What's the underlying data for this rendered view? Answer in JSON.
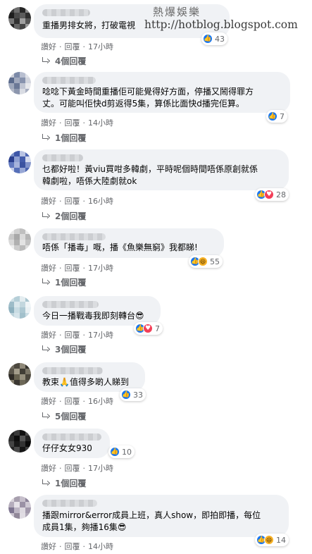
{
  "watermark": {
    "title": "熱爆娛樂",
    "url": "http://hotblog.blogspot.com"
  },
  "labels": {
    "like": "讚好",
    "reply": "回覆",
    "sep": "·"
  },
  "colors": {
    "like": "#1877f2",
    "love": "#f33e58",
    "haha": "#f7b125",
    "bubble": "#f0f2f5",
    "meta": "#65676b"
  },
  "comments": [
    {
      "text_lines": [
        "重播男排女將，打破電視"
      ],
      "reactions": [
        "like"
      ],
      "reaction_count": "43",
      "time": "17小時",
      "replies": "4個回覆"
    },
    {
      "text_lines": [
        "唸唸下黃金時間重播佢可能覺得好方面，停播又鬧得罪方",
        "丈。可能叫佢快d剪返得5集，算係比面快d播完佢算。"
      ],
      "reactions": [
        "like"
      ],
      "reaction_count": "7",
      "time": "14小時",
      "replies": "1個回覆"
    },
    {
      "text_lines": [
        "乜都好啦！黃viu買咁多韓劇，平時呢個時間唔係原創就係",
        "韓劇啦，唔係大陸劇就ok"
      ],
      "reactions": [
        "like",
        "love"
      ],
      "reaction_count": "28",
      "time": "16小時",
      "replies": "2個回覆"
    },
    {
      "text_lines": [
        "唔係「播毒」嘅，播《魚樂無窮》我都睇!"
      ],
      "reactions": [
        "like",
        "haha"
      ],
      "reaction_count": "55",
      "time": "17小時",
      "replies": "1個回覆"
    },
    {
      "text_lines": [
        "今日一播戰毒我即刻轉台😎"
      ],
      "reactions": [
        "like",
        "love"
      ],
      "reaction_count": "7",
      "time": "17小時",
      "replies": "3個回覆"
    },
    {
      "text_lines": [
        "教束🙏值得多啲人睇到"
      ],
      "reactions": [
        "like"
      ],
      "reaction_count": "33",
      "time": "16小時",
      "replies": "5個回覆"
    },
    {
      "text_lines": [
        "仔仔女女930"
      ],
      "reactions": [
        "like"
      ],
      "reaction_count": "10",
      "time": "17小時",
      "replies": "1個回覆"
    },
    {
      "text_lines": [
        "播跟mirror&error成員上班，真人show，即拍即播，每位",
        "成員1集，夠播16集😎"
      ],
      "reactions": [
        "like",
        "haha"
      ],
      "reaction_count": "14",
      "time": "14小時",
      "replies": ""
    }
  ]
}
